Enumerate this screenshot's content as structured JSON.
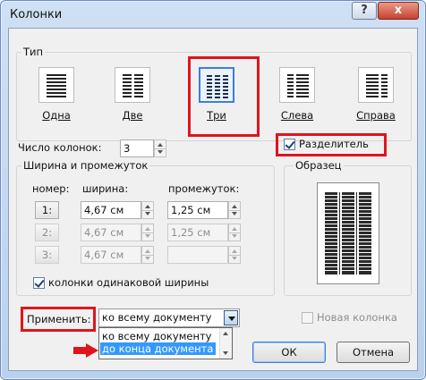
{
  "window": {
    "title": "Колонки",
    "help_glyph": "?",
    "close_glyph": "x"
  },
  "type_group": {
    "label": "Тип",
    "presets": [
      {
        "id": "one",
        "label": "Одна",
        "selected": false
      },
      {
        "id": "two",
        "label": "Две",
        "selected": false
      },
      {
        "id": "three",
        "label": "Три",
        "selected": true
      },
      {
        "id": "left",
        "label": "Слева",
        "selected": false
      },
      {
        "id": "right",
        "label": "Справа",
        "selected": false
      }
    ]
  },
  "num_columns": {
    "label": "Число колонок:",
    "value": "3"
  },
  "separator": {
    "label": "Разделитель",
    "checked": true
  },
  "width_group": {
    "label": "Ширина и промежуток",
    "col_num_header": "номер:",
    "width_header": "ширина:",
    "spacing_header": "промежуток:",
    "rows": [
      {
        "num": "1:",
        "width": "4,67 см",
        "spacing": "1,25 см",
        "enabled": true
      },
      {
        "num": "2:",
        "width": "4,67 см",
        "spacing": "1,25 см",
        "enabled": false
      },
      {
        "num": "3:",
        "width": "4,67 см",
        "spacing": "",
        "enabled": false
      }
    ]
  },
  "equal_width": {
    "label": "колонки одинаковой ширины",
    "checked": true
  },
  "preview": {
    "label": "Образец"
  },
  "apply": {
    "label": "Применить:",
    "selected": "ко всему документу",
    "options": [
      "ко всему документу",
      "до конца документа"
    ],
    "highlighted_index": 1
  },
  "new_column": {
    "label": "Новая колонка",
    "checked": false
  },
  "buttons": {
    "ok": "ОК",
    "cancel": "Отмена"
  },
  "colors": {
    "accent": "#3399ff",
    "annotation": "#e0141c"
  }
}
